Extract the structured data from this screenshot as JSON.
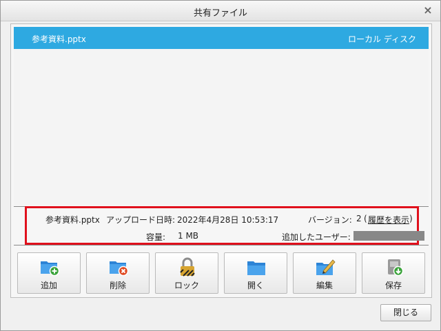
{
  "window": {
    "title": "共有ファイル",
    "close_glyph": "×"
  },
  "file_list": {
    "selected_file": {
      "name": "参考資料.pptx",
      "location": "ローカル ディスク"
    }
  },
  "details": {
    "file_name": "参考資料.pptx",
    "upload_label": "アップロード日時:",
    "upload_value": "2022年4月28日  10:53:17",
    "version_label": "バージョン:",
    "version_value": "2",
    "history_open": "(",
    "history_link": "履歴を表示",
    "history_close": ")",
    "size_label": "容量:",
    "size_value": "1 MB",
    "added_by_label": "追加したユーザー:"
  },
  "toolbar": {
    "add": "追加",
    "delete": "削除",
    "lock": "ロック",
    "open": "開く",
    "edit": "編集",
    "save": "保存"
  },
  "footer": {
    "close_button": "閉じる"
  },
  "colors": {
    "selection": "#2ea9e1",
    "highlight_border": "#e0101c",
    "folder": "#2d84d6",
    "link": "#1a4fc6"
  },
  "icons": [
    "folder-add-icon",
    "folder-delete-icon",
    "padlock-icon",
    "folder-open-icon",
    "folder-edit-icon",
    "save-download-icon",
    "close-icon"
  ]
}
